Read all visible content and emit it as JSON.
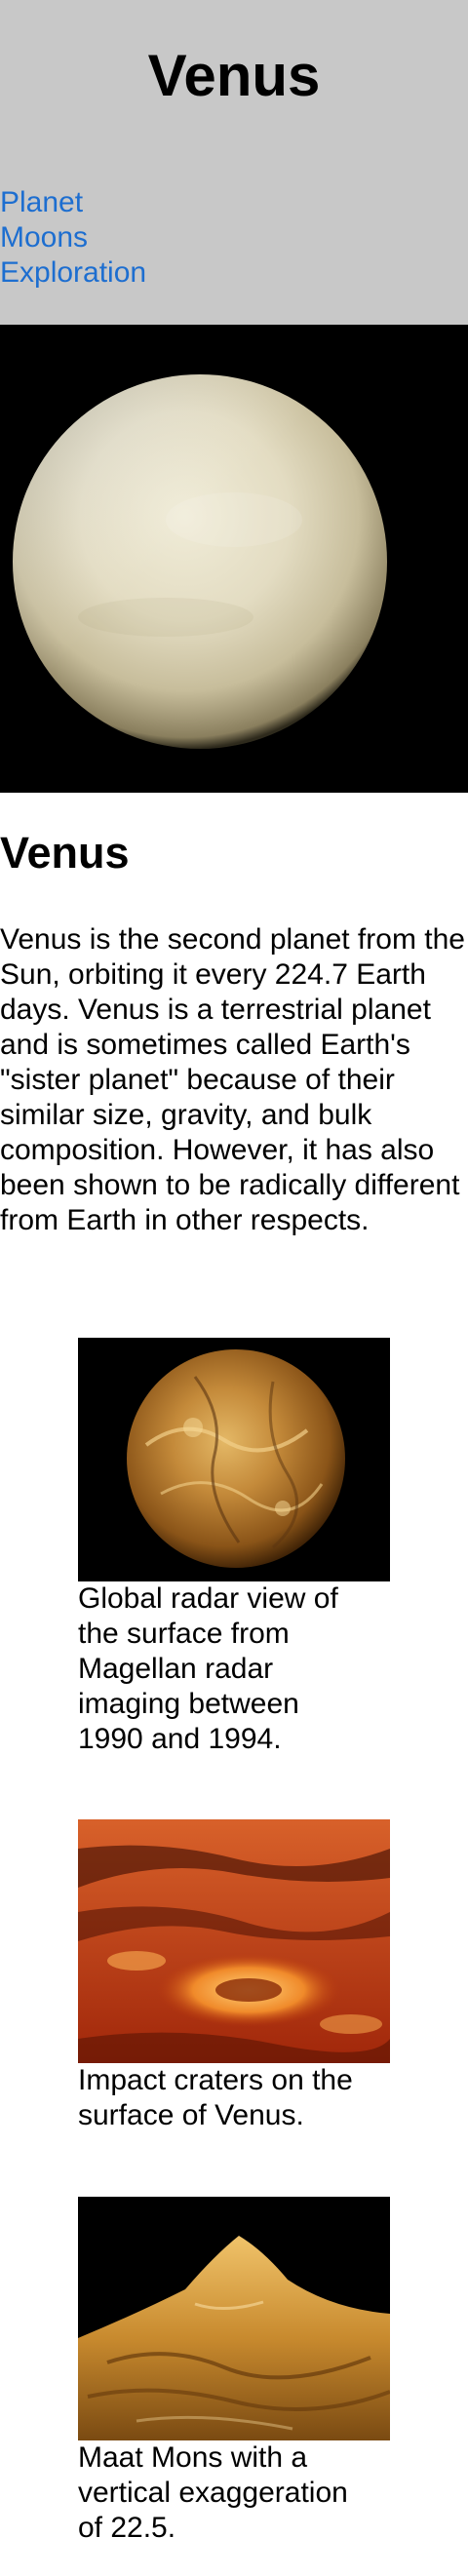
{
  "header": {
    "title": "Venus",
    "nav": [
      {
        "label": "Planet"
      },
      {
        "label": "Moons"
      },
      {
        "label": "Exploration"
      }
    ]
  },
  "main": {
    "title": "Venus",
    "intro": "Venus is the second planet from the Sun, orbiting it every 224.7 Earth days. Venus is a terrestrial planet and is sometimes called Earth's \"sister planet\" because of their similar size, gravity, and bulk composition. However, it has also been shown to be radically different from Earth in other respects.",
    "figures": [
      {
        "caption": "Global radar view of the surface from Magellan radar imaging between 1990 and 1994."
      },
      {
        "caption": "Impact craters on the surface of Venus."
      },
      {
        "caption": "Maat Mons with a vertical exaggeration of 22.5."
      }
    ]
  },
  "colors": {
    "header_bg": "#c8c8c8",
    "link": "#1d6ed0"
  }
}
